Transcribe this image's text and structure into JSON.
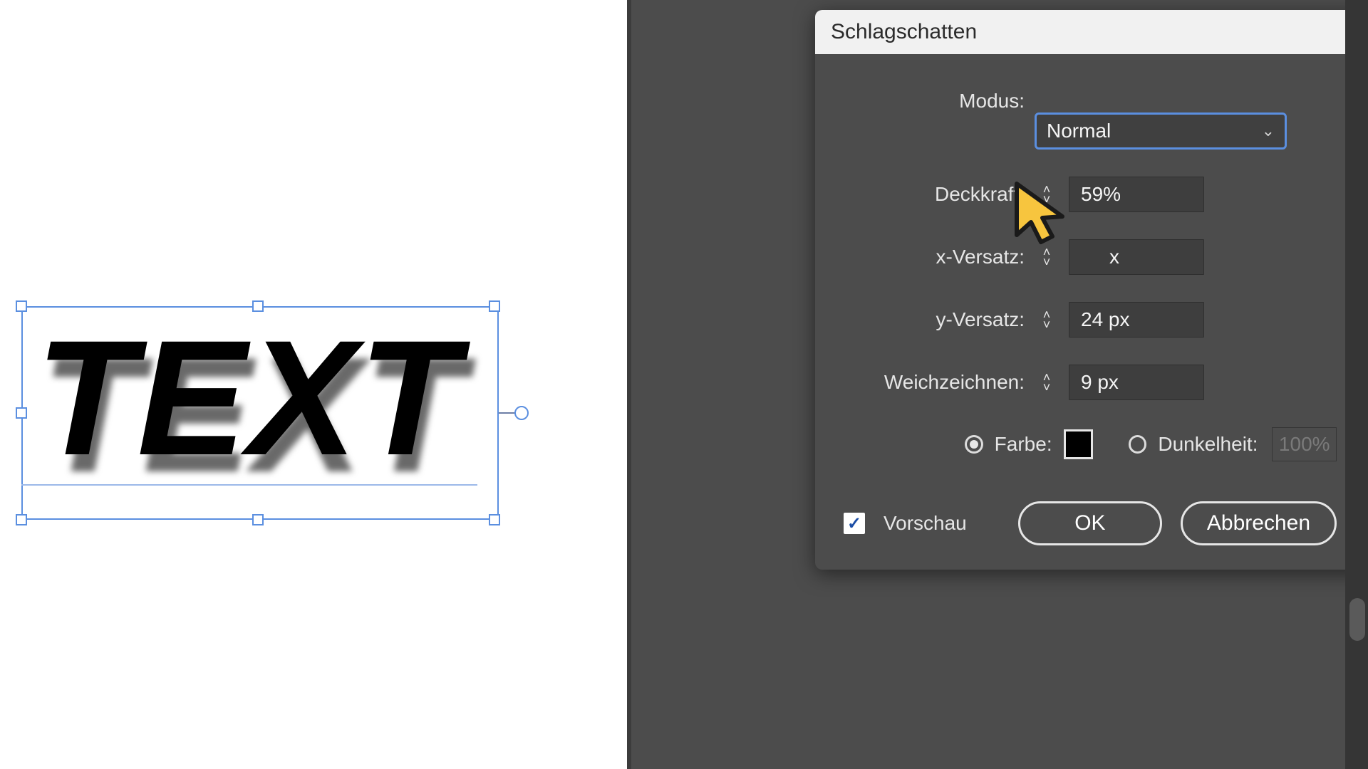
{
  "canvas": {
    "text": "TEXT"
  },
  "dialog": {
    "title": "Schlagschatten",
    "labels": {
      "mode": "Modus:",
      "opacity": "Deckkraft:",
      "x_offset": "x-Versatz:",
      "y_offset": "y-Versatz:",
      "blur": "Weichzeichnen:",
      "color": "Farbe:",
      "darkness": "Dunkelheit:",
      "preview": "Vorschau",
      "ok": "OK",
      "cancel": "Abbrechen"
    },
    "values": {
      "mode": "Normal",
      "opacity": "59%",
      "x_offset": "x",
      "y_offset": "24 px",
      "blur": "9 px",
      "color_hex": "#000000",
      "darkness_pct": "100%"
    }
  }
}
